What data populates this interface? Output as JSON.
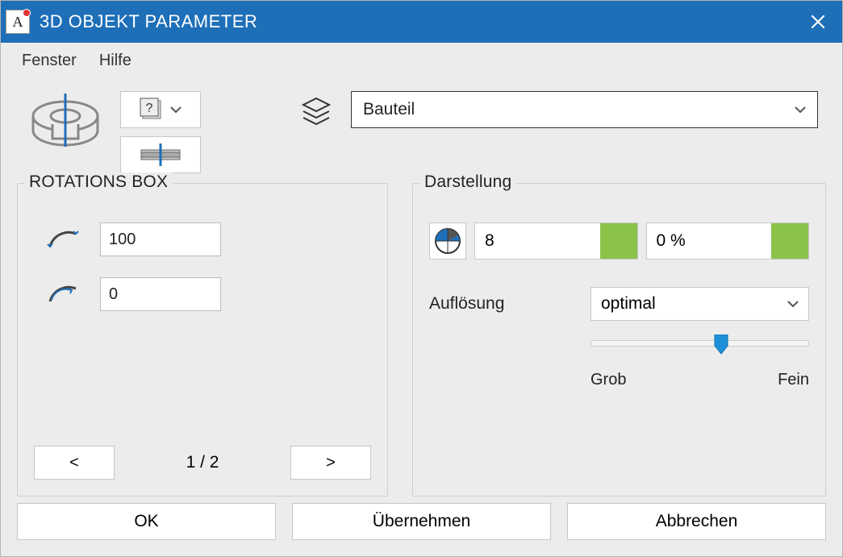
{
  "titlebar": {
    "app_icon_letter": "A",
    "title": "3D OBJEKT PARAMETER"
  },
  "menu": {
    "fenster": "Fenster",
    "hilfe": "Hilfe"
  },
  "toprow": {
    "help_icon_glyph": "?",
    "layers_label": "Bauteil"
  },
  "rotations_box": {
    "legend": "ROTATIONS BOX",
    "value1": "100",
    "value2": "0",
    "prev": "<",
    "next": ">",
    "page": "1 / 2"
  },
  "darstellung": {
    "legend": "Darstellung",
    "seg1_value": "8",
    "seg2_value": "0 %",
    "aufloesung_label": "Auflösung",
    "aufloesung_value": "optimal",
    "slider_percent": 60,
    "slider_grob": "Grob",
    "slider_fein": "Fein"
  },
  "buttons": {
    "ok": "OK",
    "apply": "Übernehmen",
    "cancel": "Abbrechen"
  },
  "colors": {
    "accent_blue": "#1e6fb8",
    "green": "#8bc34a"
  }
}
